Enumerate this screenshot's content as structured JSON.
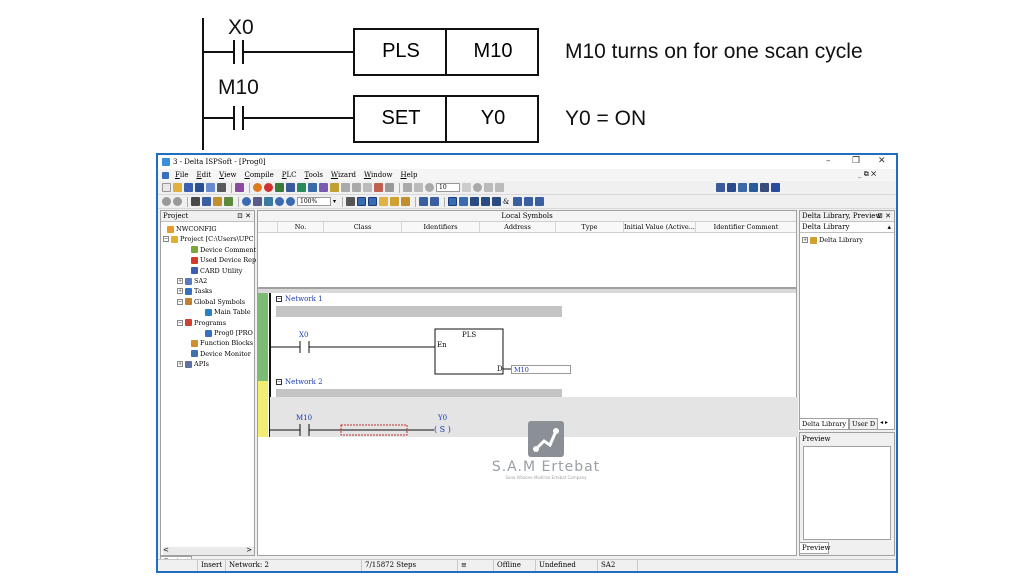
{
  "diagram": {
    "rung1": {
      "contact": "X0",
      "instruction": "PLS",
      "operand": "M10",
      "comment": "M10 turns on for one scan cycle"
    },
    "rung2": {
      "contact": "M10",
      "instruction": "SET",
      "operand": "Y0",
      "comment": "Y0 = ON"
    }
  },
  "window": {
    "title": "3 - Delta ISPSoft - [Prog0]",
    "controls": {
      "minimize": "–",
      "restore": "❐",
      "close": "✕"
    },
    "mdi_controls": "_ ⧉ ✕"
  },
  "menu": {
    "items": [
      {
        "hot": "F",
        "rest": "ile"
      },
      {
        "hot": "E",
        "rest": "dit"
      },
      {
        "hot": "V",
        "rest": "iew"
      },
      {
        "hot": "C",
        "rest": "ompile"
      },
      {
        "hot": "P",
        "rest": "LC"
      },
      {
        "hot": "T",
        "rest": "ools"
      },
      {
        "hot": "W",
        "rest": "izard"
      },
      {
        "hot": "W",
        "rest": "indow"
      },
      {
        "hot": "H",
        "rest": "elp"
      }
    ]
  },
  "toolbar": {
    "zoom_value": "100%",
    "step_value": "10",
    "ampersand": "&"
  },
  "project_panel": {
    "title": "Project",
    "pin": "⊡ ✕",
    "tab": "Project",
    "scroll_left": "<",
    "scroll_right": ">",
    "nodes": [
      {
        "label": "NWCONFIG",
        "color": "#e89a2c",
        "expander": "",
        "indent": 6
      },
      {
        "label": "Project [C:\\Users\\UPC",
        "color": "#e0b030",
        "expander": "−",
        "indent": 2
      },
      {
        "label": "Device Comment",
        "color": "#7aa83a",
        "expander": "",
        "indent": 30
      },
      {
        "label": "Used Device Rep",
        "color": "#d63a2a",
        "expander": "",
        "indent": 30
      },
      {
        "label": "CARD Utility",
        "color": "#3a5fb0",
        "expander": "",
        "indent": 30
      },
      {
        "label": "SA2",
        "color": "#5a7ac0",
        "expander": "+",
        "indent": 16
      },
      {
        "label": "Tasks",
        "color": "#3a70c0",
        "expander": "+",
        "indent": 16
      },
      {
        "label": "Global Symbols",
        "color": "#c08030",
        "expander": "−",
        "indent": 16
      },
      {
        "label": "Main Table",
        "color": "#2a80c0",
        "expander": "",
        "indent": 44
      },
      {
        "label": "Programs",
        "color": "#d04030",
        "expander": "−",
        "indent": 16
      },
      {
        "label": "Prog0 [PRO",
        "color": "#3a70c0",
        "expander": "",
        "indent": 44
      },
      {
        "label": "Function Blocks",
        "color": "#d09030",
        "expander": "",
        "indent": 30
      },
      {
        "label": "Device Monitor",
        "color": "#4070b0",
        "expander": "",
        "indent": 30
      },
      {
        "label": "APIs",
        "color": "#6070a0",
        "expander": "+",
        "indent": 16
      }
    ]
  },
  "symbols": {
    "title": "Local Symbols",
    "columns": [
      "No.",
      "Class",
      "Identifiers",
      "Address",
      "Type",
      "Initial Value (Active...",
      "Identifier Comment"
    ]
  },
  "editor": {
    "network1": {
      "box": "−",
      "label": "Network 1",
      "contact": "X0",
      "block_name": "PLS",
      "input_pin": "En",
      "output_pin": "D",
      "output_device": "M10"
    },
    "network2": {
      "box": "−",
      "label": "Network 2",
      "contact": "M10",
      "coil_device": "Y0",
      "coil_symbol": "( S )"
    }
  },
  "watermark": {
    "name": "S.A.M Ertebat",
    "subtitle": "Sana Afzoone Modiran Ertebat Company"
  },
  "library_panel": {
    "title": "Delta Library, Preview",
    "pin": "⊡ ✕",
    "subheader": "Delta Library",
    "tree_item": "Delta Library",
    "tab_active": "Delta Library",
    "tab_other": "User D",
    "preview_label": "Preview",
    "preview_tab": "Preview"
  },
  "statusbar": {
    "mode": "Insert",
    "network": "Network: 2",
    "steps": "7/15872 Steps",
    "status": "Offline",
    "driver": "Undefined Driver",
    "model": "SA2"
  }
}
